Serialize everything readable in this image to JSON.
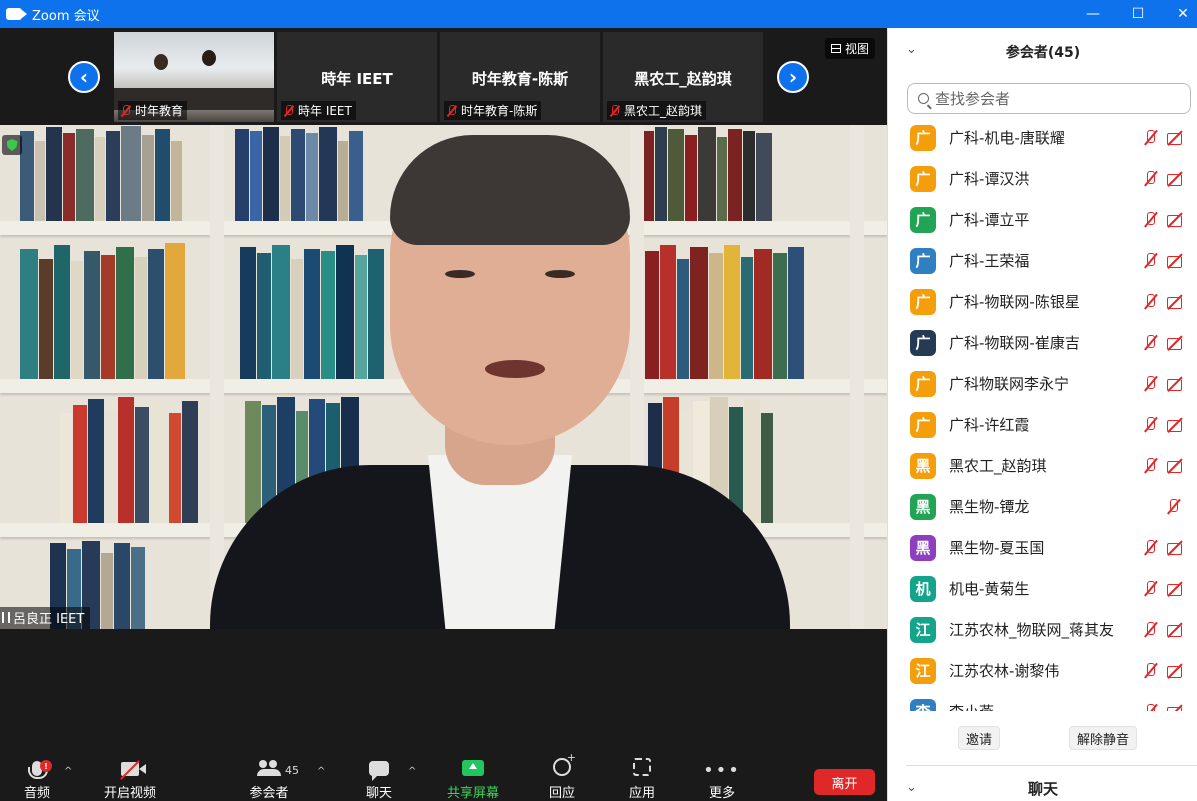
{
  "window": {
    "title": "Zoom 会议",
    "minimize": "—",
    "maximize": "☐",
    "close": "✕"
  },
  "strip": {
    "view_label": "视图",
    "prev": "‹",
    "next": "›",
    "thumbs": [
      {
        "big": "",
        "label": "时年教育"
      },
      {
        "big": "時年 IEET",
        "label": "時年 IEET"
      },
      {
        "big": "时年教育-陈斯",
        "label": "时年教育-陈斯"
      },
      {
        "big": "黑农工_赵韵琪",
        "label": "黑农工_赵韵琪"
      }
    ]
  },
  "main": {
    "speaker_label": "呂良正 IEET"
  },
  "toolbar": {
    "audio": "音频",
    "audio_badge": "!",
    "video": "开启视频",
    "participants": "参会者",
    "participants_count": "45",
    "chat": "聊天",
    "share": "共享屏幕",
    "react": "回应",
    "apps": "应用",
    "more": "更多",
    "more_glyph": "•••",
    "caret": "^",
    "leave": "离开"
  },
  "panel": {
    "collapse": "⌄",
    "title": "参会者(45)",
    "search_placeholder": "查找参会者",
    "participants": [
      {
        "avatar": "广",
        "name": "广科-机电-唐联耀",
        "color": "#f59e0b",
        "cam_off": true
      },
      {
        "avatar": "广",
        "name": "广科-谭汉洪",
        "color": "#f59e0b",
        "cam_off": true
      },
      {
        "avatar": "广",
        "name": "广科-谭立平",
        "color": "#22a455",
        "cam_off": true
      },
      {
        "avatar": "广",
        "name": "广科-王荣福",
        "color": "#2f7fc1",
        "cam_off": true
      },
      {
        "avatar": "广",
        "name": "广科-物联网-陈银星",
        "color": "#f59e0b",
        "cam_off": true
      },
      {
        "avatar": "广",
        "name": "广科-物联网-崔康吉",
        "color": "#243a55",
        "cam_off": true
      },
      {
        "avatar": "广",
        "name": "广科物联网李永宁",
        "color": "#f59e0b",
        "cam_off": true
      },
      {
        "avatar": "广",
        "name": "广科-许红霞",
        "color": "#f59e0b",
        "cam_off": true
      },
      {
        "avatar": "黑",
        "name": "黑农工_赵韵琪",
        "color": "#f59e0b",
        "cam_off": true
      },
      {
        "avatar": "黑",
        "name": "黑生物-镡龙",
        "color": "#22a455",
        "cam_off": false
      },
      {
        "avatar": "黑",
        "name": "黑生物-夏玉国",
        "color": "#8e3fbf",
        "cam_off": true
      },
      {
        "avatar": "机",
        "name": "机电-黄菊生",
        "color": "#14a38b",
        "cam_off": true
      },
      {
        "avatar": "江",
        "name": "江苏农林_物联网_蒋其友",
        "color": "#14a38b",
        "cam_off": true
      },
      {
        "avatar": "江",
        "name": "江苏农林-谢黎伟",
        "color": "#f59e0b",
        "cam_off": true
      },
      {
        "avatar": "李",
        "name": "李小燕",
        "color": "#2f7fc1",
        "cam_off": true
      }
    ],
    "invite": "邀请",
    "unmute": "解除静音",
    "chat_title": "聊天"
  }
}
